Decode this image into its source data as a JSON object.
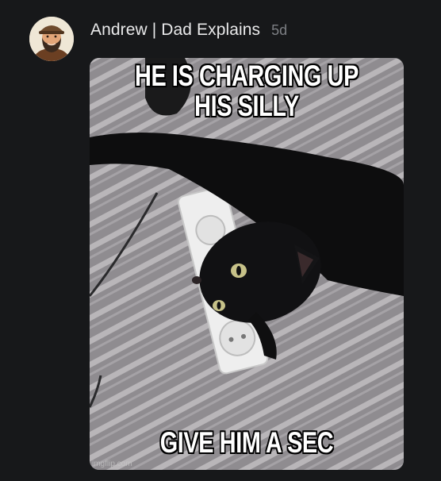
{
  "post": {
    "author": "Andrew | Dad Explains",
    "timestamp": "5d",
    "avatar_icon": "bearded-man-avatar-icon",
    "image_icon": "black-cat-on-power-strip-image",
    "meme": {
      "top_text": "HE IS CHARGING UP HIS SILLY",
      "bottom_text": "GIVE HIM A SEC",
      "watermark": "imgflip.com"
    }
  },
  "colors": {
    "background": "#17181a",
    "author_text": "#e9e9ea",
    "timestamp_text": "#7d7f84"
  }
}
